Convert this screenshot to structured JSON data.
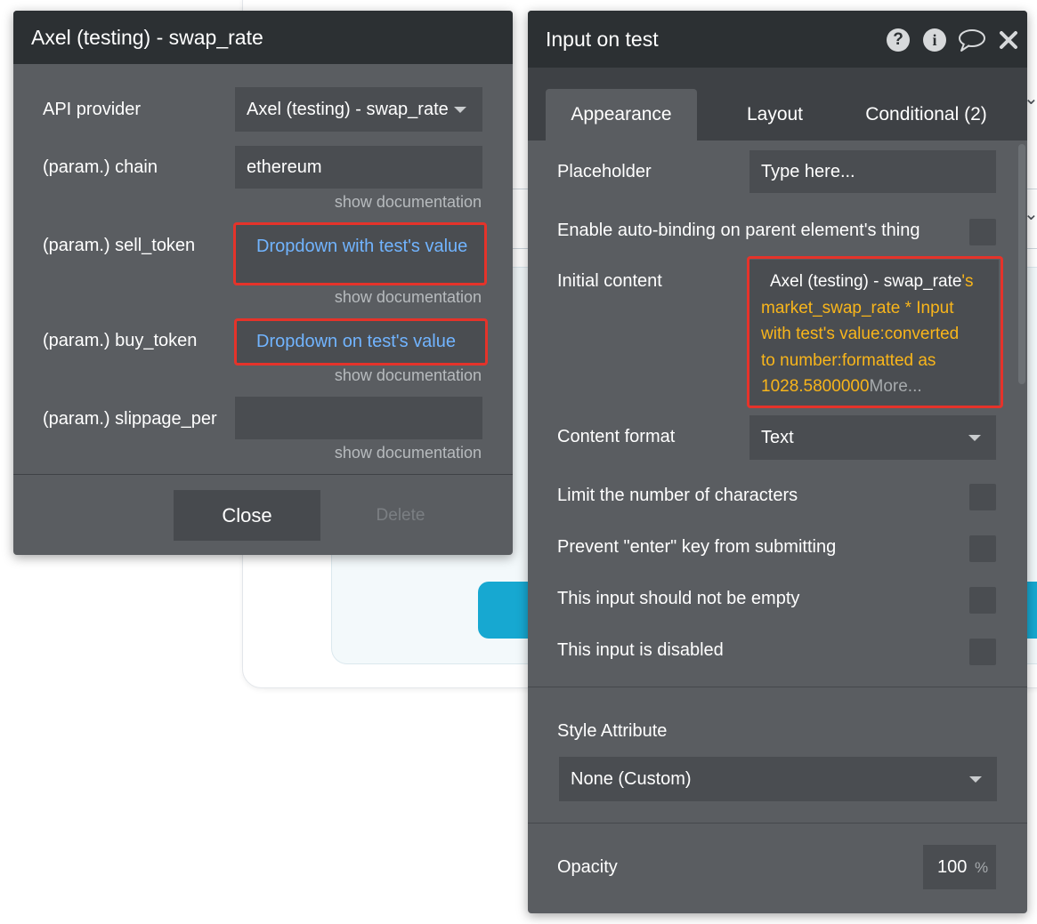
{
  "left_panel": {
    "title": "Axel (testing) - swap_rate",
    "api_provider_label": "API provider",
    "api_provider_value": "Axel (testing) - swap_rate",
    "params": [
      {
        "label": "(param.) chain",
        "value": "ethereum",
        "doc": "show documentation"
      },
      {
        "label": "(param.) sell_token",
        "value": "Dropdown with test's value",
        "doc": "show documentation"
      },
      {
        "label": "(param.) buy_token",
        "value": "Dropdown on test's value",
        "doc": "show documentation"
      },
      {
        "label": "(param.) slippage_per",
        "value": "",
        "doc": "show documentation"
      }
    ],
    "close_label": "Close",
    "delete_label": "Delete"
  },
  "right_panel": {
    "title": "Input on test",
    "tabs": [
      "Appearance",
      "Layout",
      "Conditional (2)"
    ],
    "active_tab": "Appearance",
    "placeholder_label": "Placeholder",
    "placeholder_value": "Type here...",
    "autobinding_label": "Enable auto-binding on parent element's thing",
    "initial_content_label": "Initial content",
    "initial_content": {
      "source": "Axel (testing) - swap_rate",
      "expr_line1": "'s",
      "expr_line2": "market_swap_rate * Input",
      "expr_line3": "with test's value:converted",
      "expr_line4": "to number:formatted as",
      "expr_line5": "1028.5800000",
      "more": "More..."
    },
    "content_format_label": "Content format",
    "content_format_value": "Text",
    "checkboxes": [
      "Limit the number of characters",
      "Prevent \"enter\" key from submitting",
      "This input should not be empty",
      "This input is disabled"
    ],
    "style_attribute_label": "Style Attribute",
    "style_attribute_value": "None (Custom)",
    "opacity_label": "Opacity",
    "opacity_value": "100",
    "opacity_unit": "%"
  },
  "icons": [
    "help-icon",
    "info-icon",
    "comment-icon",
    "close-icon"
  ],
  "colors": {
    "panel_bg": "#5a5d61",
    "header_bg": "#2c3033",
    "field_bg": "#4a4d51",
    "dynamic_blue": "#71b4ff",
    "expression_orange": "#f8b51b",
    "highlight_red": "#e5332a",
    "background_button": "#17a8d1"
  }
}
